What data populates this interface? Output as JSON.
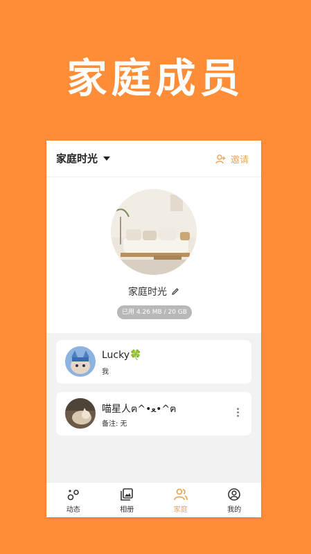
{
  "hero": {
    "title": "家庭成员"
  },
  "header": {
    "family_name": "家庭时光",
    "invite_label": "邀请"
  },
  "profile": {
    "name": "家庭时光",
    "storage": "已用 4.26 MB / 20 GB"
  },
  "members": [
    {
      "name": "Lucky🍀",
      "subtitle": "我"
    },
    {
      "name": "喵星人ฅ^•ﻌ•^ฅ",
      "subtitle": "备注: 无"
    }
  ],
  "tabs": [
    {
      "label": "动态",
      "icon": "activity-icon"
    },
    {
      "label": "相册",
      "icon": "album-icon"
    },
    {
      "label": "家庭",
      "icon": "family-icon",
      "active": true
    },
    {
      "label": "我的",
      "icon": "profile-icon"
    }
  ],
  "colors": {
    "accent": "#E8A55A",
    "background": "#FF8C36"
  }
}
